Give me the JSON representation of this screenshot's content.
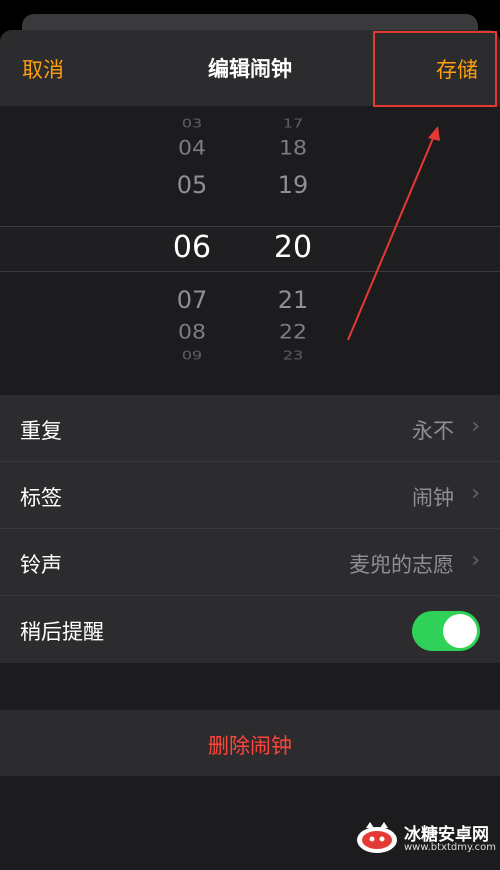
{
  "nav": {
    "cancel_label": "取消",
    "title": "编辑闹钟",
    "save_label": "存储"
  },
  "picker": {
    "hours": [
      "03",
      "04",
      "05",
      "06",
      "07",
      "08",
      "09"
    ],
    "minutes": [
      "17",
      "18",
      "19",
      "20",
      "21",
      "22",
      "23"
    ],
    "selected_hour": "06",
    "selected_minute": "20"
  },
  "settings": {
    "repeat": {
      "label": "重复",
      "value": "永不"
    },
    "tag": {
      "label": "标签",
      "value": "闹钟"
    },
    "ringtone": {
      "label": "铃声",
      "value": "麦兜的志愿"
    },
    "snooze": {
      "label": "稍后提醒",
      "on": true
    }
  },
  "delete_label": "删除闹钟",
  "colors": {
    "accent": "#ff9f0a",
    "destructive": "#ff453a",
    "toggle_on": "#30d158",
    "annotation": "#e53935"
  },
  "watermark": {
    "name": "冰糖安卓网",
    "url": "www.btxtdmy.com"
  }
}
